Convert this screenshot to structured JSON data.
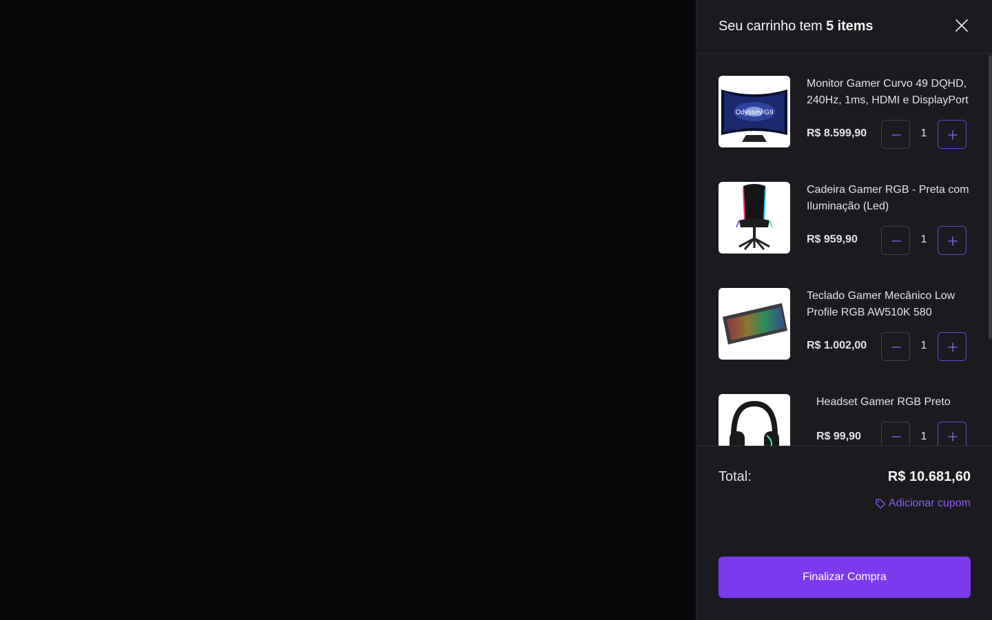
{
  "cart": {
    "title_prefix": "Seu carrinho tem",
    "title_count": "5 items",
    "items": [
      {
        "name": "Monitor Gamer Curvo 49 DQHD, 240Hz, 1ms, HDMI e DisplayPort",
        "price": "R$ 8.599,90",
        "qty": "1",
        "thumb_text": "Odyssey G9"
      },
      {
        "name": "Cadeira Gamer RGB - Preta com Iluminação (Led)",
        "price": "R$ 959,90",
        "qty": "1"
      },
      {
        "name": "Teclado Gamer Mecânico Low Profile RGB AW510K 580",
        "price": "R$ 1.002,00",
        "qty": "1"
      },
      {
        "name": "Headset Gamer RGB Preto",
        "price": "R$ 99,90",
        "qty": "1"
      }
    ]
  },
  "footer": {
    "total_label": "Total:",
    "total_value": "R$ 10.681,60",
    "coupon_label": "Adicionar cupom",
    "checkout_label": "Finalizar Compra"
  },
  "icons": {
    "close": "close-icon",
    "minus": "minus-icon",
    "plus": "plus-icon",
    "tag": "tag-icon"
  },
  "colors": {
    "accent": "#7c3aed",
    "accent_text": "#8b5cf6",
    "panel": "#1b1b1f",
    "backdrop": "#09090b"
  }
}
